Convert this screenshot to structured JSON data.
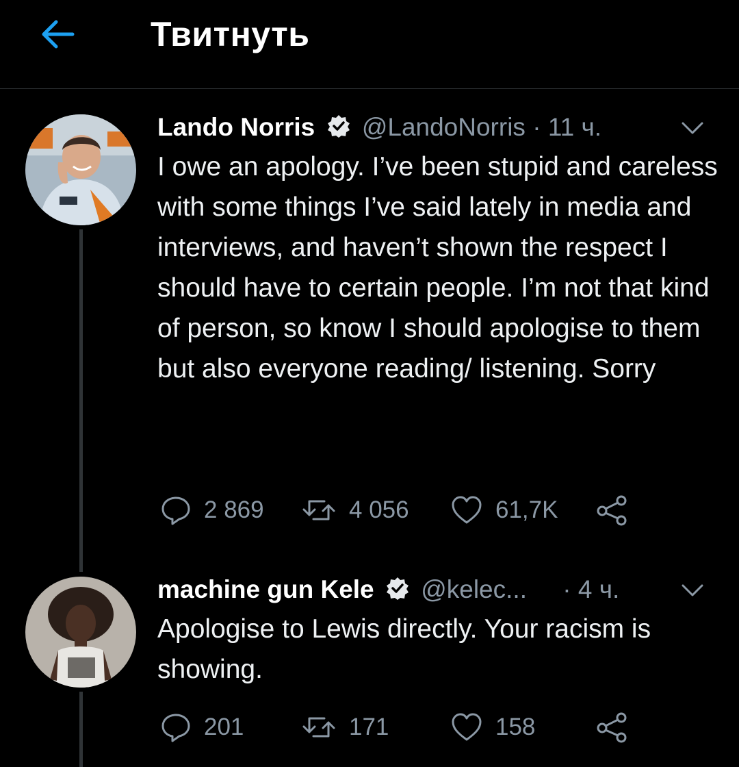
{
  "header": {
    "title": "Твитнуть"
  },
  "tweets": [
    {
      "name": "Lando Norris",
      "handle": "@LandoNorris",
      "dot": "·",
      "time": "11 ч.",
      "text": "I owe an apology. I’ve been stupid and careless with some things I’ve said lately in media and interviews, and haven’t shown the respect I should have to certain people. I’m not that kind of person, so know I should apologise to them but also everyone reading/ listening. Sorry",
      "replies": "2 869",
      "retweets": "4 056",
      "likes": "61,7K"
    },
    {
      "name": "machine gun Kele",
      "handle": "@kelec...",
      "dot": "·",
      "time": "4 ч.",
      "text": "Apologise to Lewis directly. Your racism is showing.",
      "replies": "201",
      "retweets": "171",
      "likes": "158"
    }
  ],
  "colors": {
    "accent": "#1da1f2",
    "background": "#000000",
    "muted": "#8b98a5",
    "divider": "#2f3336"
  },
  "icons": {
    "back": "arrow-left-icon",
    "verified": "verified-badge-icon",
    "chevron": "chevron-down-icon",
    "reply": "reply-icon",
    "retweet": "retweet-icon",
    "like": "heart-icon",
    "share": "share-icon"
  }
}
